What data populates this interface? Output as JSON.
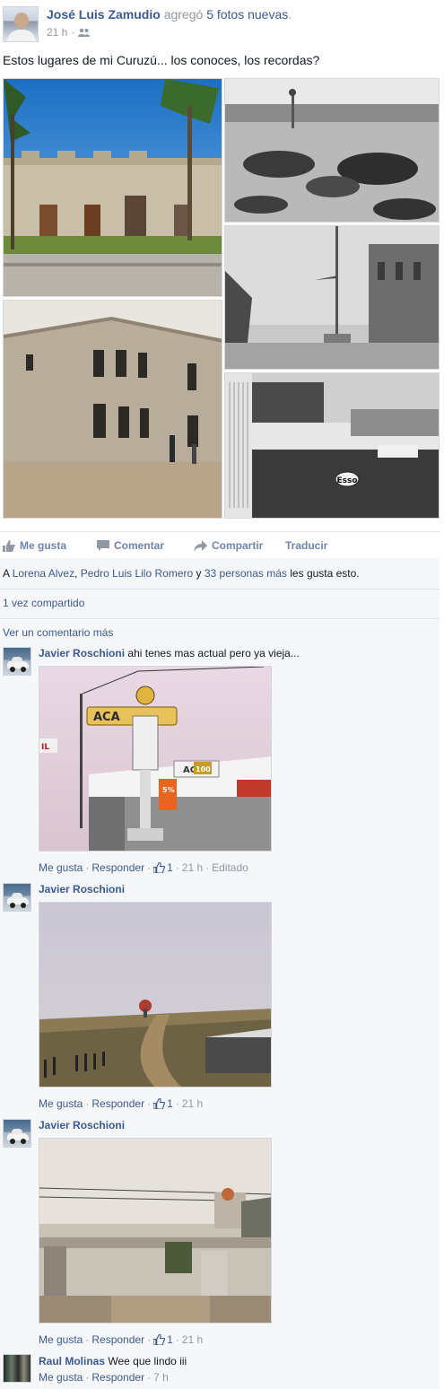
{
  "post": {
    "author": "José Luis Zamudio",
    "action": "agregó",
    "photos_link": "5 fotos nuevas",
    "period": ".",
    "time": "21 h",
    "audience_icon": "friends-icon",
    "text": "Estos lugares de mi Curuzú... los conoces, los recordas?"
  },
  "actions": {
    "like": "Me gusta",
    "comment": "Comentar",
    "share": "Compartir",
    "translate": "Traducir"
  },
  "likes": {
    "prefix": "A",
    "person1": "Lorena Alvez",
    "sep": ",",
    "person2": "Pedro Luis Lilo Romero",
    "and": "y",
    "others": "33 personas más",
    "suffix": "les gusta esto."
  },
  "shares": "1 vez compartido",
  "more_comments": "Ver un comentario más",
  "comments": [
    {
      "author": "Javier Roschioni",
      "text": "ahi tenes mas actual pero ya vieja...",
      "like": "Me gusta",
      "reply": "Responder",
      "likes_count": "1",
      "time": "21 h",
      "edited": "Editado",
      "photo_sign_aca": "ACA",
      "photo_sign_5": "5%",
      "photo_sign_100": "100",
      "photo_sign_il": "IL"
    },
    {
      "author": "Javier Roschioni",
      "text": "",
      "like": "Me gusta",
      "reply": "Responder",
      "likes_count": "1",
      "time": "21 h"
    },
    {
      "author": "Javier Roschioni",
      "text": "",
      "like": "Me gusta",
      "reply": "Responder",
      "likes_count": "1",
      "time": "21 h"
    },
    {
      "author": "Raul Molinas",
      "text": "Wee que lindo iii",
      "like": "Me gusta",
      "reply": "Responder",
      "time": "7 h"
    }
  ],
  "photo_esso_label": "Esso",
  "sep_dot": "·",
  "colors": {
    "link": "#3b5998",
    "muted": "#9197a3",
    "action": "#6d84b4",
    "ufi_bg": "#f6f7f9"
  }
}
